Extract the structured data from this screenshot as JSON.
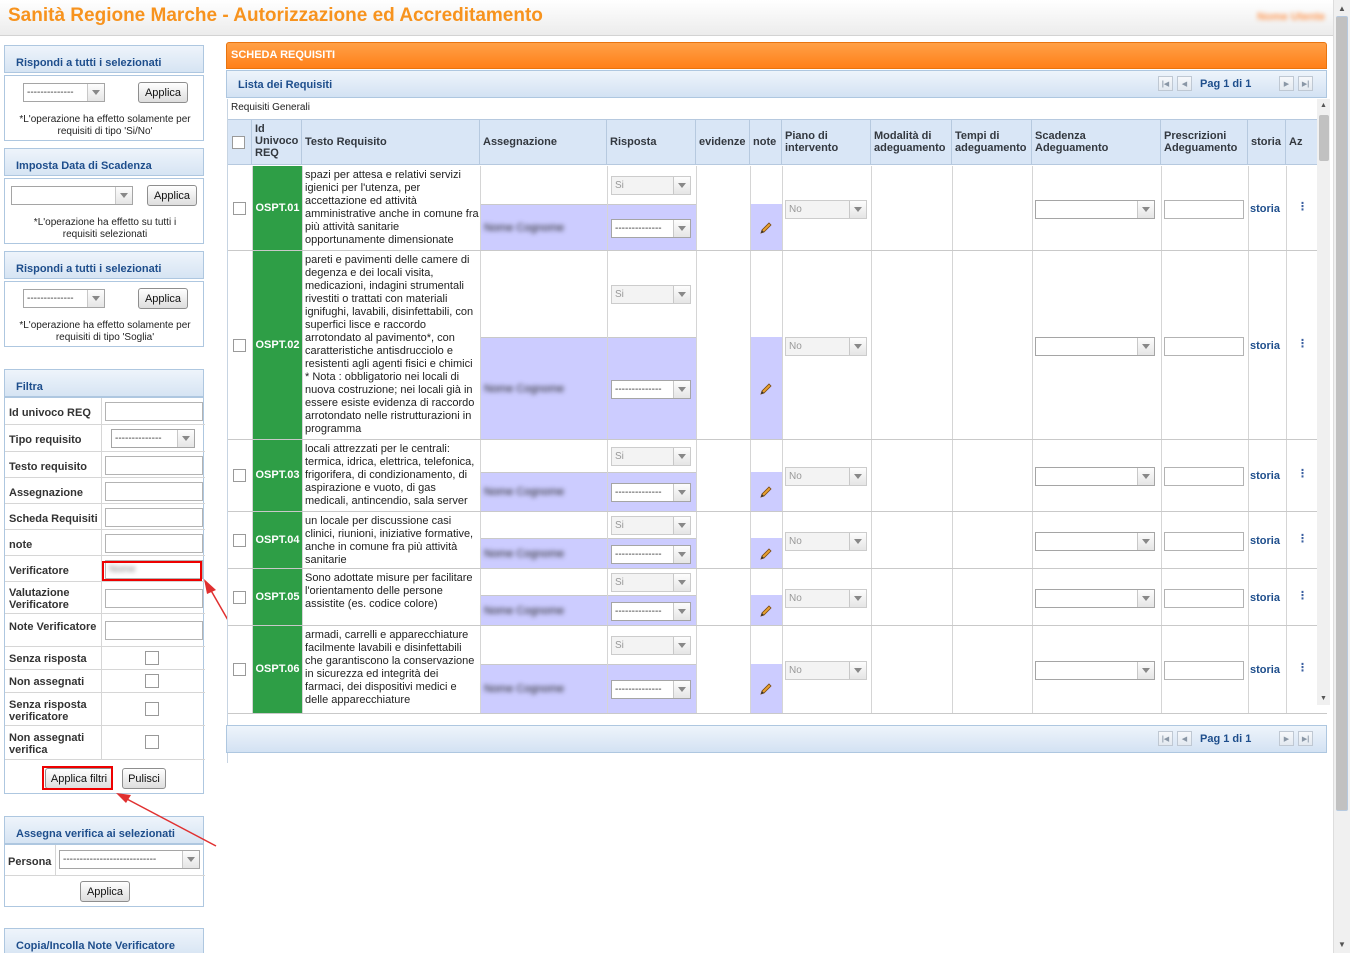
{
  "app": {
    "title": "Sanità Regione Marche - Autorizzazione ed Accreditamento",
    "user": "Nome Utente"
  },
  "sidebar": {
    "rispondi1": {
      "title": "Rispondi a tutti i selezionati",
      "select_value": "--------------",
      "apply": "Applica",
      "note": "*L'operazione ha effetto solamente per requisiti di tipo 'Si/No'"
    },
    "scadenza": {
      "title": "Imposta Data di Scadenza",
      "select_value": "",
      "apply": "Applica",
      "note": "*L'operazione ha effetto su tutti i requisiti selezionati"
    },
    "rispondi2": {
      "title": "Rispondi a tutti i selezionati",
      "select_value": "--------------",
      "apply": "Applica",
      "note": "*L'operazione ha effetto solamente per requisiti di tipo 'Soglia'"
    },
    "filtra": {
      "title": "Filtra",
      "fields": [
        {
          "label": "Id univoco REQ",
          "value": ""
        },
        {
          "label": "Tipo requisito",
          "value": "--------------"
        },
        {
          "label": "Testo requisito",
          "value": ""
        },
        {
          "label": "Assegnazione",
          "value": ""
        },
        {
          "label": "Scheda Requisiti",
          "value": ""
        },
        {
          "label": "note",
          "value": ""
        },
        {
          "label": "Verificatore",
          "value": "Nome"
        },
        {
          "label": "Valutazione Verificatore",
          "value": ""
        },
        {
          "label": "Note Verificatore",
          "value": ""
        }
      ],
      "checks": [
        "Senza risposta",
        "Non assegnati",
        "Senza risposta verificatore",
        "Non assegnati verifica"
      ],
      "apply": "Applica filtri",
      "clear": "Pulisci"
    },
    "assegna": {
      "title": "Assegna verifica ai selezionati",
      "persona_label": "Persona",
      "persona_value": "----------------------------",
      "apply": "Applica"
    },
    "copia": {
      "title": "Copia/Incolla Note Verificatore"
    }
  },
  "main": {
    "panel_title": "SCHEDA REQUISITI",
    "list_title": "Lista dei Requisiti",
    "pager": "Pag 1 di 1",
    "group": "Requisiti Generali",
    "columns": {
      "id": "Id Univoco REQ",
      "testo": "Testo Requisito",
      "assegnazione": "Assegnazione",
      "risposta": "Risposta",
      "evidenze": "evidenze",
      "note": "note",
      "piano": "Piano di intervento",
      "modalita": "Modalità di adeguamento",
      "tempi": "Tempi di adeguamento",
      "scadenza": "Scadenza Adeguamento",
      "prescrizioni": "Prescrizioni Adeguamento",
      "storia": "storia",
      "az": "Az"
    },
    "rows": [
      {
        "id": "OSPT.01",
        "text": "spazi per attesa e relativi servizi igienici per l'utenza, per accettazione ed attività amministrative anche in comune fra più attività sanitarie opportunamente dimensionate",
        "assegnato": "Nome Cognome",
        "risposta1": "Si",
        "risposta2": "--------------",
        "piano": "No",
        "storia": "storia"
      },
      {
        "id": "OSPT.02",
        "text": "pareti e pavimenti delle camere di degenza e dei locali visita, medicazioni, indagini strumentali rivestiti o trattati con materiali ignifughi, lavabili, disinfettabili, con superfici lisce e raccordo arrotondato al pavimento*, con caratteristiche antisdrucciolo e resistenti agli agenti fisici e chimici * Nota : obbligatorio nei locali di nuova costruzione; nei locali già in essere esiste evidenza di raccordo arrotondato nelle ristrutturazioni in programma",
        "assegnato": "Nome Cognome",
        "risposta1": "Si",
        "risposta2": "--------------",
        "piano": "No",
        "storia": "storia"
      },
      {
        "id": "OSPT.03",
        "text": "locali attrezzati per le centrali: termica, idrica, elettrica, telefonica, frigorifera, di condizionamento, di aspirazione e vuoto, di gas medicali, antincendio, sala server",
        "assegnato": "Nome Cognome",
        "risposta1": "Si",
        "risposta2": "--------------",
        "piano": "No",
        "storia": "storia"
      },
      {
        "id": "OSPT.04",
        "text": "un locale per discussione casi clinici, riunioni, iniziative formative, anche in comune fra più attività sanitarie",
        "assegnato": "Nome Cognome",
        "risposta1": "Si",
        "risposta2": "--------------",
        "piano": "No",
        "storia": "storia"
      },
      {
        "id": "OSPT.05",
        "text": "Sono adottate misure per facilitare l'orientamento delle persone assistite (es. codice colore)",
        "assegnato": "Nome Cognome",
        "risposta1": "Si",
        "risposta2": "--------------",
        "piano": "No",
        "storia": "storia"
      },
      {
        "id": "OSPT.06",
        "text": "armadi, carrelli e apparecchiature facilmente lavabili e disinfettabili che garantiscono la conservazione in sicurezza ed integrità dei farmaci, dei dispositivi medici e delle apparecchiature",
        "assegnato": "Nome Cognome",
        "risposta1": "Si",
        "risposta2": "--------------",
        "piano": "No",
        "storia": "storia"
      }
    ]
  },
  "colors": {
    "orange": "#ff8a2a",
    "green": "#2e9e46",
    "purple": "#ccccff",
    "blue": "#1e4e8c"
  }
}
